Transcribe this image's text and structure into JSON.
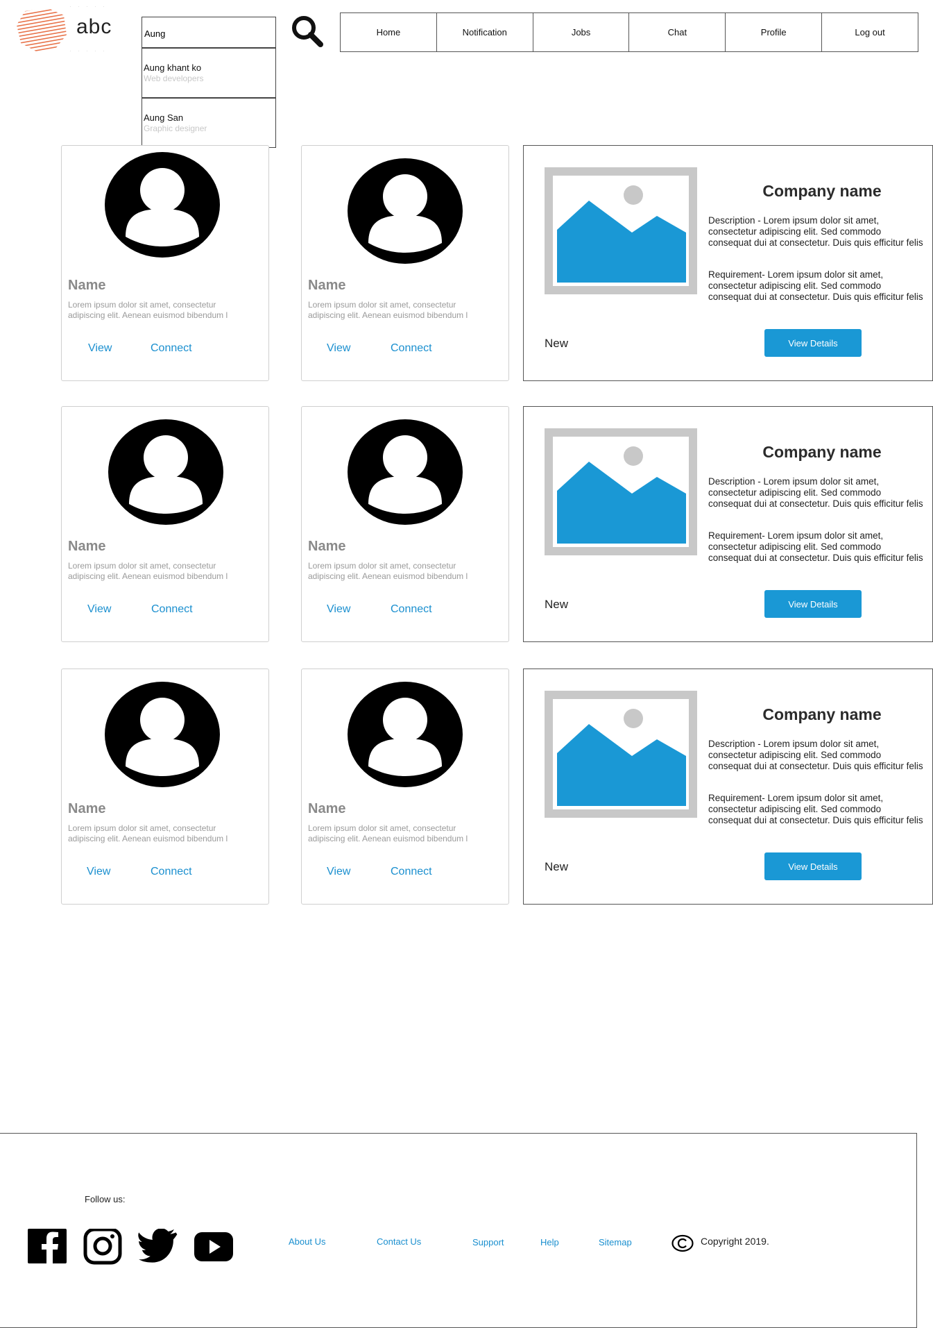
{
  "header": {
    "logo_text": "abc",
    "search": {
      "value": "Aung"
    },
    "suggestions": [
      {
        "name": "Aung khant ko",
        "role": "Web developers"
      },
      {
        "name": "Aung San",
        "role": "Graphic designer"
      }
    ],
    "nav": [
      "Home",
      "Notification",
      "Jobs",
      "Chat",
      "Profile",
      "Log out"
    ]
  },
  "people": [
    {
      "name": "Name",
      "desc": "Lorem ipsum dolor sit amet, consectetur adipiscing elit. Aenean euismod bibendum l",
      "view": "View",
      "connect": "Connect"
    },
    {
      "name": "Name",
      "desc": "Lorem ipsum dolor sit amet, consectetur adipiscing elit. Aenean euismod bibendum l",
      "view": "View",
      "connect": "Connect"
    },
    {
      "name": "Name",
      "desc": "Lorem ipsum dolor sit amet, consectetur adipiscing elit. Aenean euismod bibendum l",
      "view": "View",
      "connect": "Connect"
    },
    {
      "name": "Name",
      "desc": "Lorem ipsum dolor sit amet, consectetur adipiscing elit. Aenean euismod bibendum l",
      "view": "View",
      "connect": "Connect"
    },
    {
      "name": "Name",
      "desc": "Lorem ipsum dolor sit amet, consectetur adipiscing elit. Aenean euismod bibendum l",
      "view": "View",
      "connect": "Connect"
    },
    {
      "name": "Name",
      "desc": "Lorem ipsum dolor sit amet, consectetur adipiscing elit. Aenean euismod bibendum l",
      "view": "View",
      "connect": "Connect"
    }
  ],
  "companies": [
    {
      "title": "Company name",
      "description": [
        "Description - Lorem ipsum dolor sit amet,",
        "consectetur adipiscing elit. Sed commodo",
        "consequat dui at consectetur. Duis quis efficitur felis"
      ],
      "requirement": [
        "Requirement- Lorem ipsum dolor sit amet,",
        "consectetur adipiscing elit. Sed commodo",
        "consequat dui at consectetur. Duis quis efficitur felis"
      ],
      "status": "New",
      "button": "View Details"
    },
    {
      "title": "Company name",
      "description": [
        "Description - Lorem ipsum dolor sit amet,",
        "consectetur adipiscing elit. Sed commodo",
        "consequat dui at consectetur. Duis quis efficitur felis"
      ],
      "requirement": [
        "Requirement- Lorem ipsum dolor sit amet,",
        "consectetur adipiscing elit. Sed commodo",
        "consequat dui at consectetur. Duis quis efficitur felis"
      ],
      "status": "New",
      "button": "View Details"
    },
    {
      "title": "Company name",
      "description": [
        "Description - Lorem ipsum dolor sit amet,",
        "consectetur adipiscing elit. Sed commodo",
        "consequat dui at consectetur. Duis quis efficitur felis"
      ],
      "requirement": [
        "Requirement- Lorem ipsum dolor sit amet,",
        "consectetur adipiscing elit. Sed commodo",
        "consequat dui at consectetur. Duis quis efficitur felis"
      ],
      "status": "New",
      "button": "View Details"
    }
  ],
  "footer": {
    "follow": "Follow us:",
    "social_icons": [
      "facebook-icon",
      "instagram-icon",
      "twitter-icon",
      "youtube-icon"
    ],
    "links": [
      "About Us",
      "Contact Us",
      "Support",
      "Help",
      "Sitemap"
    ],
    "copyright": "Copyright 2019."
  },
  "colors": {
    "accent": "#1a98d5",
    "link": "#1a8fcf",
    "logo": "#e8734a"
  }
}
